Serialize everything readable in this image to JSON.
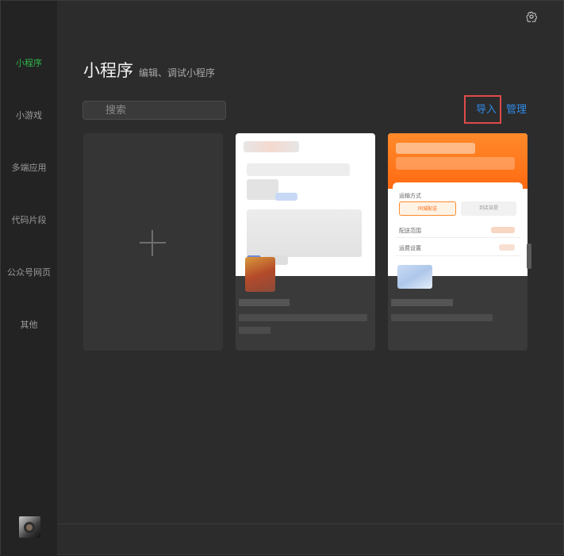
{
  "sidebar": {
    "items": [
      {
        "label": "小程序",
        "active": true
      },
      {
        "label": "小游戏"
      },
      {
        "label": "多端应用"
      },
      {
        "label": "代码片段"
      },
      {
        "label": "公众号网页"
      },
      {
        "label": "其他"
      }
    ],
    "active_color": "#2fb34b"
  },
  "header": {
    "title": "小程序",
    "subtitle": "编辑、调试小程序"
  },
  "search": {
    "placeholder": "搜索"
  },
  "actions": {
    "import_label": "导入",
    "manage_label": "管理",
    "link_color": "#2f8ae8",
    "highlight_color": "#e04a4a"
  },
  "icons": {
    "settings": "gear-icon",
    "search": "search-icon",
    "create": "plus-icon"
  },
  "card2_preview": {
    "section_label": "运输方式",
    "option_left": "同城配送",
    "option_right": "到店自提",
    "row1": "配送范围",
    "row2": "运费设置"
  }
}
